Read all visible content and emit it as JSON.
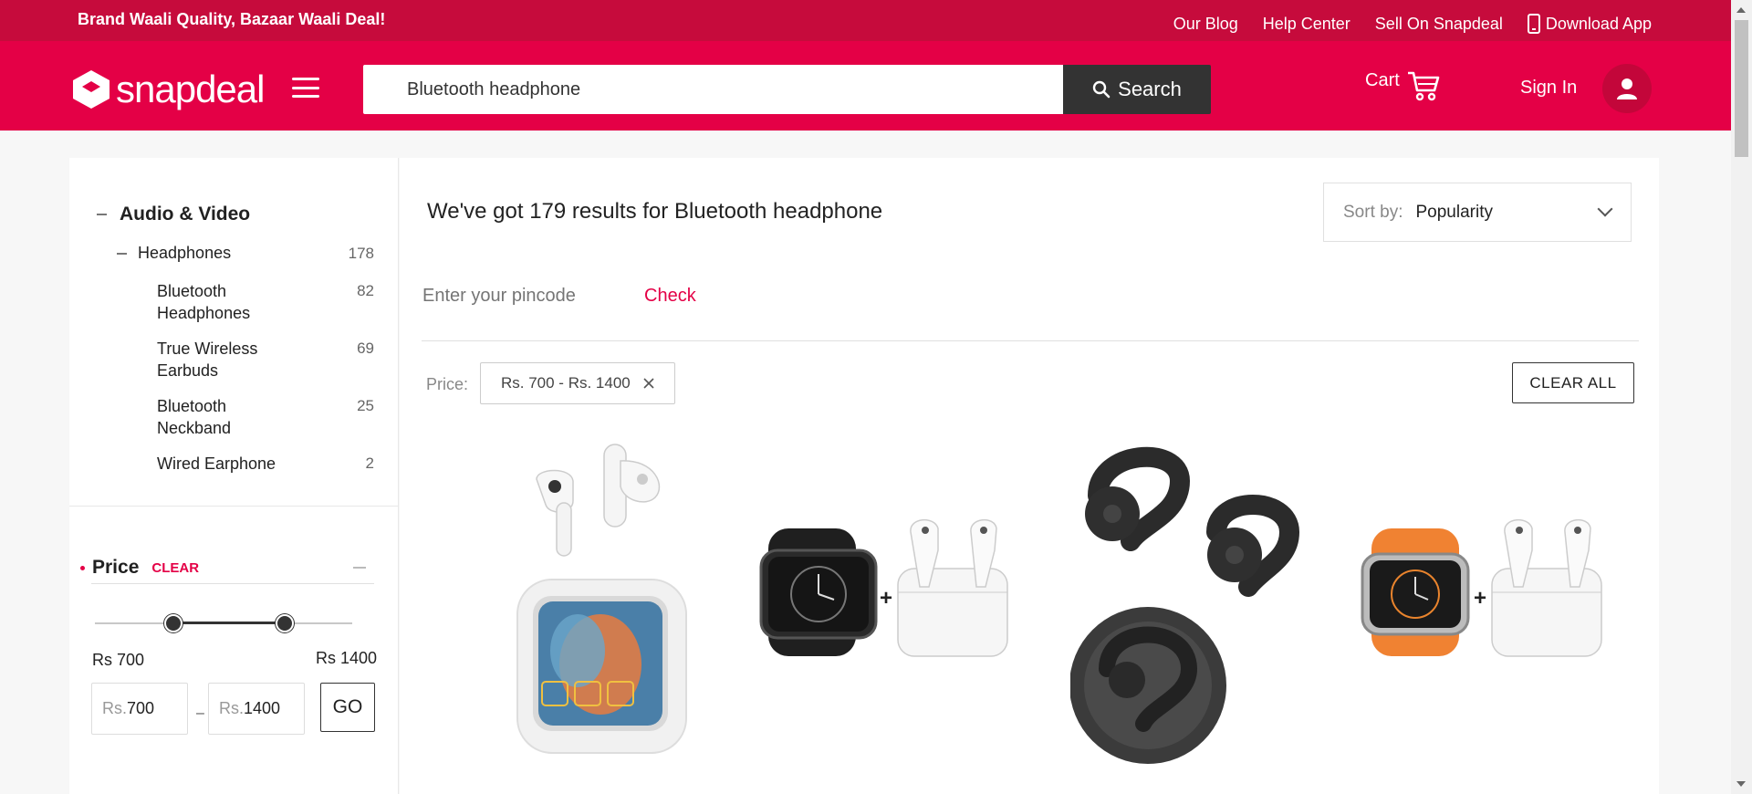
{
  "topbar": {
    "tagline": "Brand Waali Quality, Bazaar Waali Deal!",
    "links": [
      "Our Blog",
      "Help Center",
      "Sell On Snapdeal"
    ],
    "download_label": "Download App"
  },
  "header": {
    "logo_text": "snapdeal",
    "search_value": "Bluetooth headphone",
    "search_button": "Search",
    "cart_label": "Cart",
    "signin_label": "Sign In"
  },
  "sidebar": {
    "category": "Audio & Video",
    "subcategory": {
      "label": "Headphones",
      "count": "178"
    },
    "items": [
      {
        "label": "Bluetooth Headphones",
        "count": "82"
      },
      {
        "label": "True Wireless Earbuds",
        "count": "69"
      },
      {
        "label": "Bluetooth Neckband",
        "count": "25"
      },
      {
        "label": "Wired Earphone",
        "count": "2"
      }
    ],
    "price": {
      "title": "Price",
      "clear": "CLEAR",
      "min_label": "Rs 700",
      "max_label": "Rs 1400",
      "currency": "Rs.",
      "min_value": "700",
      "max_value": "1400",
      "go": "GO",
      "range_low_fraction": 0.31,
      "range_high_fraction": 0.74
    }
  },
  "main": {
    "results_text": "We've got 179 results for Bluetooth headphone",
    "sort_label": "Sort by:",
    "sort_value": "Popularity",
    "pincode_placeholder": "Enter your pincode",
    "check_label": "Check",
    "filter_label": "Price:",
    "filter_chip": "Rs. 700 - Rs. 1400",
    "clear_all": "CLEAR ALL",
    "products": [
      {
        "image": "earbuds-with-touchscreen-case"
      },
      {
        "image": "black-smartwatch-plus-earbuds"
      },
      {
        "image": "open-ear-black-earbuds"
      },
      {
        "image": "orange-smartwatch-plus-earbuds"
      }
    ]
  },
  "colors": {
    "brand": "#e40046",
    "topbar": "#c60b3c",
    "dark": "#333333"
  }
}
